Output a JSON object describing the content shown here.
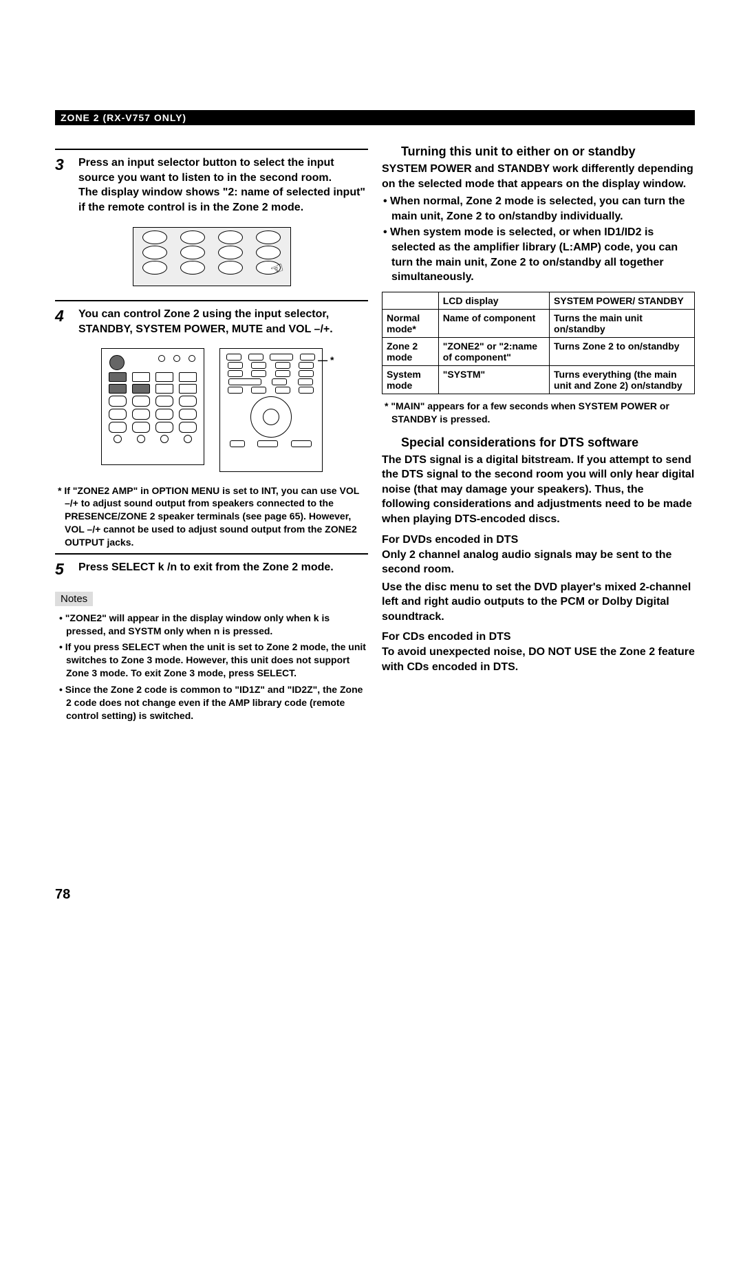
{
  "header": "ZONE 2 (RX-V757 ONLY)",
  "left": {
    "step3": {
      "num": "3",
      "line1": "Press an input selector button to select the input source you want to listen to in the second room.",
      "line2": "The display window shows \"2: name of selected input\" if the remote control is in the Zone 2 mode."
    },
    "step4": {
      "num": "4",
      "text": "You can control Zone 2 using the input selector, STANDBY, SYSTEM POWER, MUTE and VOL –/+."
    },
    "footnote4": "If \"ZONE2 AMP\" in OPTION MENU is set to INT, you can use VOL –/+ to adjust sound output from speakers connected to the PRESENCE/ZONE 2 speaker terminals (see page 65). However, VOL –/+ cannot be used to adjust sound output from the ZONE2 OUTPUT jacks.",
    "step5": {
      "num": "5",
      "text": "Press SELECT k /n  to exit from the Zone 2 mode."
    },
    "notes_label": "Notes",
    "note1": "\"ZONE2\" will appear in the display window only when k is pressed, and SYSTM only when n is pressed.",
    "note2": "If you press SELECT when the unit is set to Zone 2 mode, the unit switches to Zone 3 mode. However, this unit does not support Zone 3 mode. To exit Zone 3 mode, press SELECT.",
    "note3": "Since the Zone 2 code is common to \"ID1Z\" and \"ID2Z\", the Zone 2 code does not change even if the AMP library code (remote control setting) is switched."
  },
  "right": {
    "h1": "Turning this unit to either on or standby",
    "p1": "SYSTEM POWER and STANDBY work differently depending on the selected mode that appears on the display window.",
    "b1": "When normal, Zone 2 mode is selected, you can turn the main unit, Zone 2 to on/standby individually.",
    "b2": "When system mode is selected, or when ID1/ID2 is selected as the amplifier library (L:AMP) code, you can turn the main unit, Zone 2 to on/standby all together simultaneously.",
    "table": {
      "h_blank": "",
      "h_lcd": "LCD display",
      "h_sys": "SYSTEM POWER/ STANDBY",
      "r1c1": "Normal mode*",
      "r1c2": "Name of component",
      "r1c3": "Turns the main unit on/standby",
      "r2c1": "Zone 2 mode",
      "r2c2": "\"ZONE2\" or \"2:name of component\"",
      "r2c3": "Turns Zone 2 to on/standby",
      "r3c1": "System mode",
      "r3c2": "\"SYSTM\"",
      "r3c3": "Turns everything (the main unit and Zone 2) on/standby"
    },
    "tnote": "\"MAIN\" appears for a few seconds when SYSTEM POWER or STANDBY is pressed.",
    "h2": "Special considerations for DTS software",
    "p2": "The DTS signal is a digital bitstream. If you attempt to send the DTS signal to the second room you will only hear digital noise (that may damage your speakers). Thus, the following considerations and adjustments need to be made when playing DTS-encoded discs.",
    "sub1": "For DVDs encoded in DTS",
    "p3": "Only 2 channel analog audio signals may be sent to the second room.",
    "p4": "Use the disc menu to set the DVD player's mixed 2-channel left and right audio outputs to the PCM or Dolby Digital soundtrack.",
    "sub2": "For CDs encoded in DTS",
    "p5": "To avoid unexpected noise, DO NOT USE the Zone 2 feature with CDs encoded in DTS."
  },
  "page_number": "78"
}
